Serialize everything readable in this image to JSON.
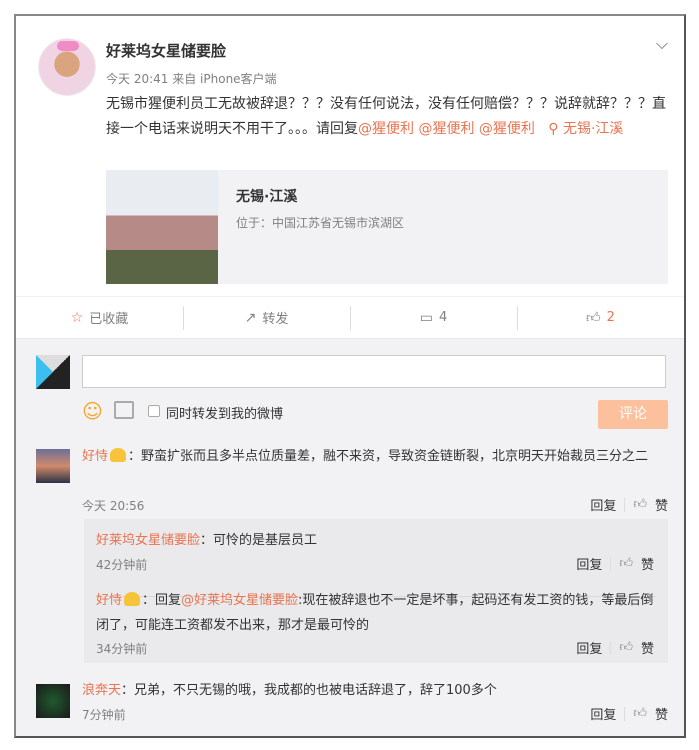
{
  "post": {
    "author": "好莱坞女星储要脸",
    "time": "今天 20:41",
    "source": "来自 iPhone客户端",
    "text": "无锡市猩便利员工无故被辞退？？？没有任何说法，没有任何赔偿？？？说辞就辞？？？直接一个电话来说明天不用干了。。。请回复",
    "mentions": [
      "@猩便利",
      "@猩便利",
      "@猩便利"
    ],
    "location": "无锡·江溪",
    "card": {
      "title": "无锡·江溪",
      "subtitle": "位于：中国江苏省无锡市滨湖区"
    }
  },
  "actions": {
    "favorite": "已收藏",
    "repost": "转发",
    "comment": "4",
    "like": "2"
  },
  "composer": {
    "checkbox_label": "同时转发到我的微博",
    "submit": "评论",
    "input_value": ""
  },
  "comments": [
    {
      "user": "好恃",
      "text": "：野蛮扩张而且多半点位质量差，融不来资，导致资金链断裂，北京明天开始裁员三分之二",
      "time": "今天 20:56",
      "reply": "回复",
      "like": "赞",
      "replies": [
        {
          "user": "好莱坞女星储要脸",
          "text": "：可怜的是基层员工",
          "time": "42分钟前",
          "reply": "回复",
          "like": "赞"
        },
        {
          "user": "好恃",
          "prefix": "：回复",
          "mention": "@好莱坞女星储要脸",
          "text": ":现在被辞退也不一定是坏事，起码还有发工资的钱，等最后倒闭了，可能连工资都发不出来，那才是最可怜的",
          "time": "34分钟前",
          "reply": "回复",
          "like": "赞"
        }
      ]
    },
    {
      "user": "浪奔天",
      "text": "：兄弟，不只无锡的哦，我成都的也被电话辞退了，辞了100多个",
      "time": "7分钟前",
      "reply": "回复",
      "like": "赞"
    }
  ]
}
